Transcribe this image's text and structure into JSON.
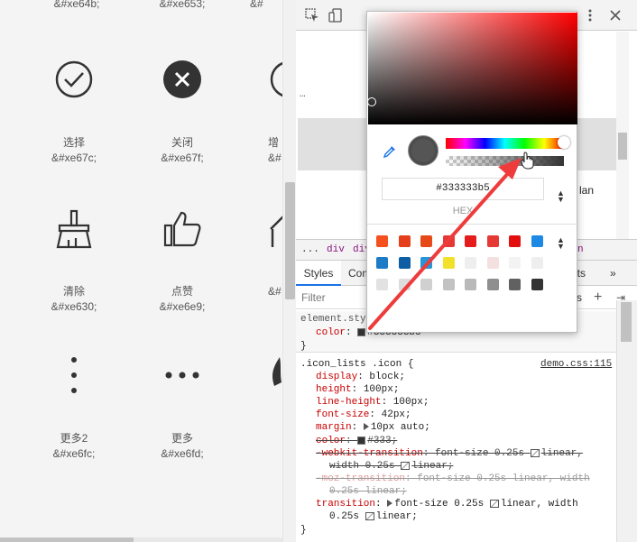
{
  "left_page": {
    "top_codes": [
      "&#xe64b;",
      "&#xe653;",
      "&#"
    ],
    "icons": [
      {
        "name": "选择",
        "code": "&#xe67c;"
      },
      {
        "name": "关闭",
        "code": "&#xe67f;"
      },
      {
        "name": "增",
        "code": "&#"
      },
      {
        "name": "清除",
        "code": "&#xe630;"
      },
      {
        "name": "点赞",
        "code": "&#xe6e9;"
      },
      {
        "name": "",
        "code": "&#"
      },
      {
        "name": "更多2",
        "code": "&#xe6fc;"
      },
      {
        "name": "更多",
        "code": "&#xe6fd;"
      }
    ]
  },
  "devtools": {
    "dots": "…",
    "right_partial": "lan",
    "breadcrumbs": [
      "...",
      "div",
      "div",
      "n"
    ],
    "tabs": {
      "styles": "Styles",
      "computed": "Com",
      "events": "nts",
      "more": "»"
    },
    "filter": {
      "placeholder": "Filter",
      "hov": "s",
      "plus": "+",
      "newrule": "⇥"
    },
    "element_style": {
      "selector": "element.sty",
      "prop": "color",
      "value": "#333333b5",
      "close": "}"
    },
    "rule": {
      "selector": ".icon_lists .icon {",
      "source": "demo.css:115",
      "declarations": [
        {
          "prop": "display",
          "value": "block;"
        },
        {
          "prop": "height",
          "value": "100px;"
        },
        {
          "prop": "line-height",
          "value": "100px;"
        },
        {
          "prop": "font-size",
          "value": "42px;"
        },
        {
          "prop": "margin",
          "value": "10px auto;"
        },
        {
          "prop": "color",
          "value": "#333;"
        },
        {
          "prop": "-webkit-transition",
          "value": "font-size 0.25s",
          "value2": "linear,",
          "cont": "width 0.25s",
          "cont2": "linear;"
        },
        {
          "prop": "-moz-transition",
          "value": "font-size 0.25s linear, width",
          "cont": "0.25s linear;"
        },
        {
          "prop": "transition",
          "value": "font-size 0.25s",
          "value2": "linear, width",
          "cont": "0.25s",
          "cont2": "linear;"
        }
      ],
      "close": "}"
    }
  },
  "picker": {
    "hex": "#333333b5",
    "format": "HEX",
    "arrows": "▲\n▼",
    "palette": [
      "#f4511e",
      "#e53e1a",
      "#e64a19",
      "#e53935",
      "#e51c1c",
      "#e53935",
      "#e30e0e",
      "#1e88e5",
      "#1e7bc6",
      "#0d5ea5",
      "#2596d8",
      "#f2e12a",
      "#eeeeee",
      "#f5e0e0",
      "#f3f3f3",
      "#eeeeee",
      "#e2e2e2",
      "#dddddd",
      "#d0d0d0",
      "#c2c2c2",
      "#b9b9b9",
      "#8f8f8f",
      "#616161",
      "#333333"
    ]
  }
}
